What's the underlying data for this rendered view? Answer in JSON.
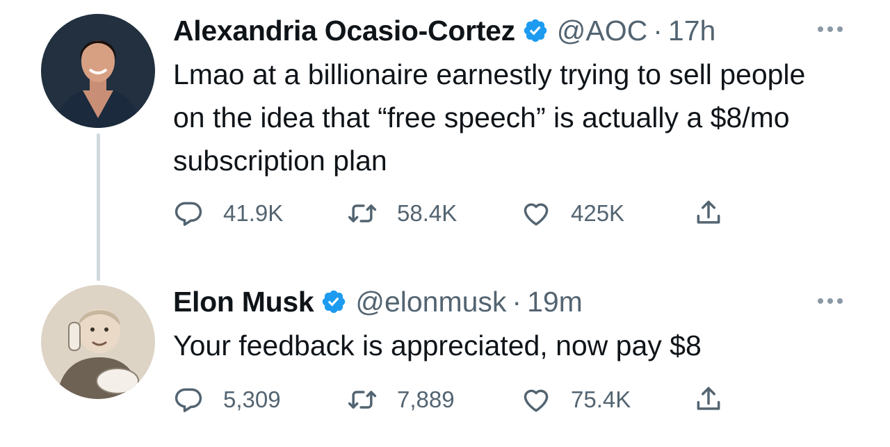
{
  "tweets": [
    {
      "author": "Alexandria Ocasio-Cortez",
      "handle": "@AOC",
      "separator": "·",
      "time": "17h",
      "text": "Lmao at a billionaire earnestly trying to sell people on the idea that “free speech” is actually a $8/mo subscription plan",
      "replies": "41.9K",
      "retweets": "58.4K",
      "likes": "425K"
    },
    {
      "author": "Elon Musk",
      "handle": "@elonmusk",
      "separator": "·",
      "time": "19m",
      "text": "Your feedback is appreciated, now pay $8",
      "replies": "5,309",
      "retweets": "7,889",
      "likes": "75.4K"
    }
  ],
  "icons": {
    "verified": "verified-badge-icon",
    "reply": "reply-icon",
    "retweet": "retweet-icon",
    "like": "like-icon",
    "share": "share-icon",
    "more": "more-icon"
  },
  "colors": {
    "verified": "#1d9bf0",
    "muted": "#536471",
    "thread_line": "#cfd9de"
  }
}
